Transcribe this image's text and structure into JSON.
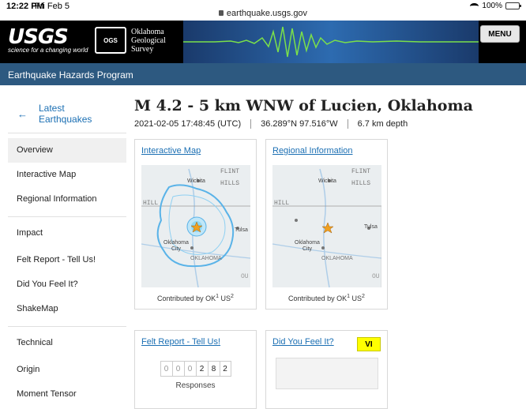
{
  "status": {
    "time": "12:22 PM",
    "date": "Fri Feb 5",
    "url": "earthquake.usgs.gov",
    "battery": "100%"
  },
  "header": {
    "usgs_mark": "USGS",
    "usgs_tagline": "science for a changing world",
    "ogs_seal": "OGS",
    "ogs_name_1": "Oklahoma",
    "ogs_name_2": "Geological",
    "ogs_name_3": "Survey",
    "menu_label": "MENU"
  },
  "program": "Earthquake Hazards Program",
  "sidebar": {
    "back_label": "Latest Earthquakes",
    "items_top": [
      "Overview",
      "Interactive Map",
      "Regional Information"
    ],
    "impact_head": "Impact",
    "items_impact": [
      "Felt Report - Tell Us!",
      "Did You Feel It?",
      "ShakeMap"
    ],
    "technical_head": "Technical",
    "items_technical": [
      "Origin",
      "Moment Tensor"
    ]
  },
  "event": {
    "title": "M 4.2 - 5 km WNW of Lucien, Oklahoma",
    "time": "2021-02-05 17:48:45 (UTC)",
    "coords": "36.289°N 97.516°W",
    "depth": "6.7 km depth"
  },
  "cards": {
    "interactive": {
      "title": "Interactive Map",
      "contrib": "Contributed by OK",
      "contrib_sup1": "1",
      "contrib_us": "US",
      "contrib_sup2": "2"
    },
    "regional": {
      "title": "Regional Information",
      "contrib": "Contributed by OK",
      "contrib_sup1": "1",
      "contrib_us": "US",
      "contrib_sup2": "2"
    },
    "felt": {
      "title": "Felt Report - Tell Us!",
      "digits": [
        "0",
        "0",
        "0",
        "2",
        "8",
        "2"
      ],
      "responses": "Responses"
    },
    "dyfi": {
      "title": "Did You Feel It?",
      "badge": "VI"
    }
  },
  "map_labels": {
    "flint": "FLINT",
    "hills": "HILLS",
    "hills_left": "HILL",
    "wichita": "Wichita",
    "tulsa": "Tulsa",
    "oklahoma_city": "Oklahoma",
    "city": "City",
    "state": "OKLAHOMA",
    "ou": "OU"
  },
  "colors": {
    "link": "#1b6fb3",
    "program_bar": "#2d5980",
    "badge": "#ffff00",
    "star": "#f0a020"
  }
}
